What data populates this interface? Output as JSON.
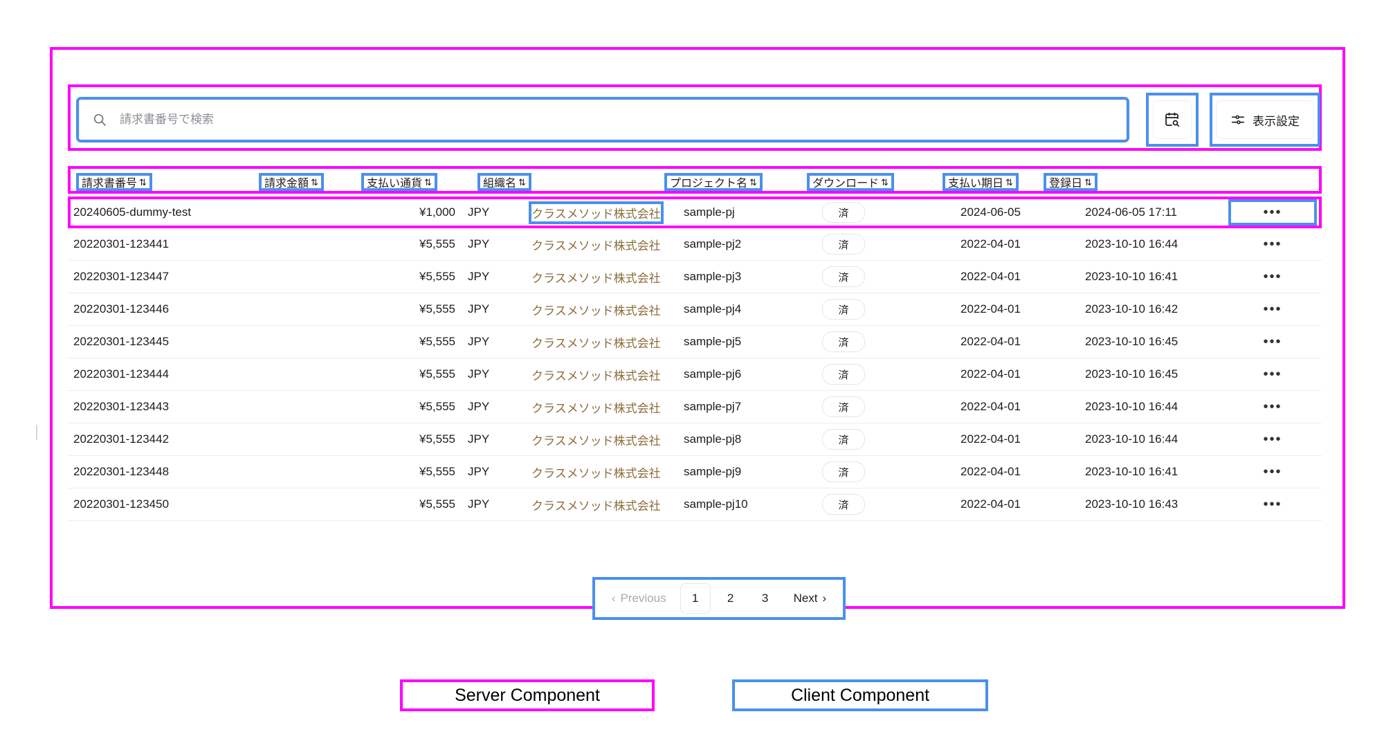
{
  "toolbar": {
    "search": {
      "placeholder": "請求書番号で検索",
      "value": "",
      "icon": "search-icon"
    },
    "calendar_button": {
      "icon": "calendar-search-icon"
    },
    "display_settings_button": {
      "label": "表示設定",
      "icon": "sliders-icon"
    }
  },
  "table": {
    "columns": [
      {
        "label": "請求書番号",
        "sort_icon": "sort-chevrons-icon"
      },
      {
        "label": "請求金額",
        "sort_icon": "sort-chevrons-icon"
      },
      {
        "label": "支払い通貨",
        "sort_icon": "sort-chevrons-icon"
      },
      {
        "label": "組織名",
        "sort_icon": "sort-chevrons-icon"
      },
      {
        "label": "プロジェクト名",
        "sort_icon": "sort-chevrons-icon"
      },
      {
        "label": "ダウンロード",
        "sort_icon": "sort-chevrons-icon"
      },
      {
        "label": "支払い期日",
        "sort_icon": "sort-chevrons-icon"
      },
      {
        "label": "登録日",
        "sort_icon": "sort-chevrons-icon"
      }
    ],
    "rows": [
      {
        "invoice_no": "20240605-dummy-test",
        "amount": "¥1,000",
        "currency": "JPY",
        "org": "クラスメソッド株式会社",
        "project": "sample-pj",
        "download": "済",
        "due_date": "2024-06-05",
        "registered_at": "2024-06-05 17:11",
        "menu": "•••"
      },
      {
        "invoice_no": "20220301-123441",
        "amount": "¥5,555",
        "currency": "JPY",
        "org": "クラスメソッド株式会社",
        "project": "sample-pj2",
        "download": "済",
        "due_date": "2022-04-01",
        "registered_at": "2023-10-10 16:44",
        "menu": "•••"
      },
      {
        "invoice_no": "20220301-123447",
        "amount": "¥5,555",
        "currency": "JPY",
        "org": "クラスメソッド株式会社",
        "project": "sample-pj3",
        "download": "済",
        "due_date": "2022-04-01",
        "registered_at": "2023-10-10 16:41",
        "menu": "•••"
      },
      {
        "invoice_no": "20220301-123446",
        "amount": "¥5,555",
        "currency": "JPY",
        "org": "クラスメソッド株式会社",
        "project": "sample-pj4",
        "download": "済",
        "due_date": "2022-04-01",
        "registered_at": "2023-10-10 16:42",
        "menu": "•••"
      },
      {
        "invoice_no": "20220301-123445",
        "amount": "¥5,555",
        "currency": "JPY",
        "org": "クラスメソッド株式会社",
        "project": "sample-pj5",
        "download": "済",
        "due_date": "2022-04-01",
        "registered_at": "2023-10-10 16:45",
        "menu": "•••"
      },
      {
        "invoice_no": "20220301-123444",
        "amount": "¥5,555",
        "currency": "JPY",
        "org": "クラスメソッド株式会社",
        "project": "sample-pj6",
        "download": "済",
        "due_date": "2022-04-01",
        "registered_at": "2023-10-10 16:45",
        "menu": "•••"
      },
      {
        "invoice_no": "20220301-123443",
        "amount": "¥5,555",
        "currency": "JPY",
        "org": "クラスメソッド株式会社",
        "project": "sample-pj7",
        "download": "済",
        "due_date": "2022-04-01",
        "registered_at": "2023-10-10 16:44",
        "menu": "•••"
      },
      {
        "invoice_no": "20220301-123442",
        "amount": "¥5,555",
        "currency": "JPY",
        "org": "クラスメソッド株式会社",
        "project": "sample-pj8",
        "download": "済",
        "due_date": "2022-04-01",
        "registered_at": "2023-10-10 16:44",
        "menu": "•••"
      },
      {
        "invoice_no": "20220301-123448",
        "amount": "¥5,555",
        "currency": "JPY",
        "org": "クラスメソッド株式会社",
        "project": "sample-pj9",
        "download": "済",
        "due_date": "2022-04-01",
        "registered_at": "2023-10-10 16:41",
        "menu": "•••"
      },
      {
        "invoice_no": "20220301-123450",
        "amount": "¥5,555",
        "currency": "JPY",
        "org": "クラスメソッド株式会社",
        "project": "sample-pj10",
        "download": "済",
        "due_date": "2022-04-01",
        "registered_at": "2023-10-10 16:43",
        "menu": "•••"
      }
    ]
  },
  "pagination": {
    "previous_label": "Previous",
    "next_label": "Next",
    "pages": [
      "1",
      "2",
      "3"
    ],
    "current_page": "1"
  },
  "legend": {
    "server_label": "Server Component",
    "client_label": "Client Component"
  },
  "colors": {
    "server_annotation": "#ff00ff",
    "client_annotation": "#4a90ed",
    "org_link": "#8a6d3b",
    "row_divider": "#ededed",
    "muted_text": "#a7abaf"
  }
}
